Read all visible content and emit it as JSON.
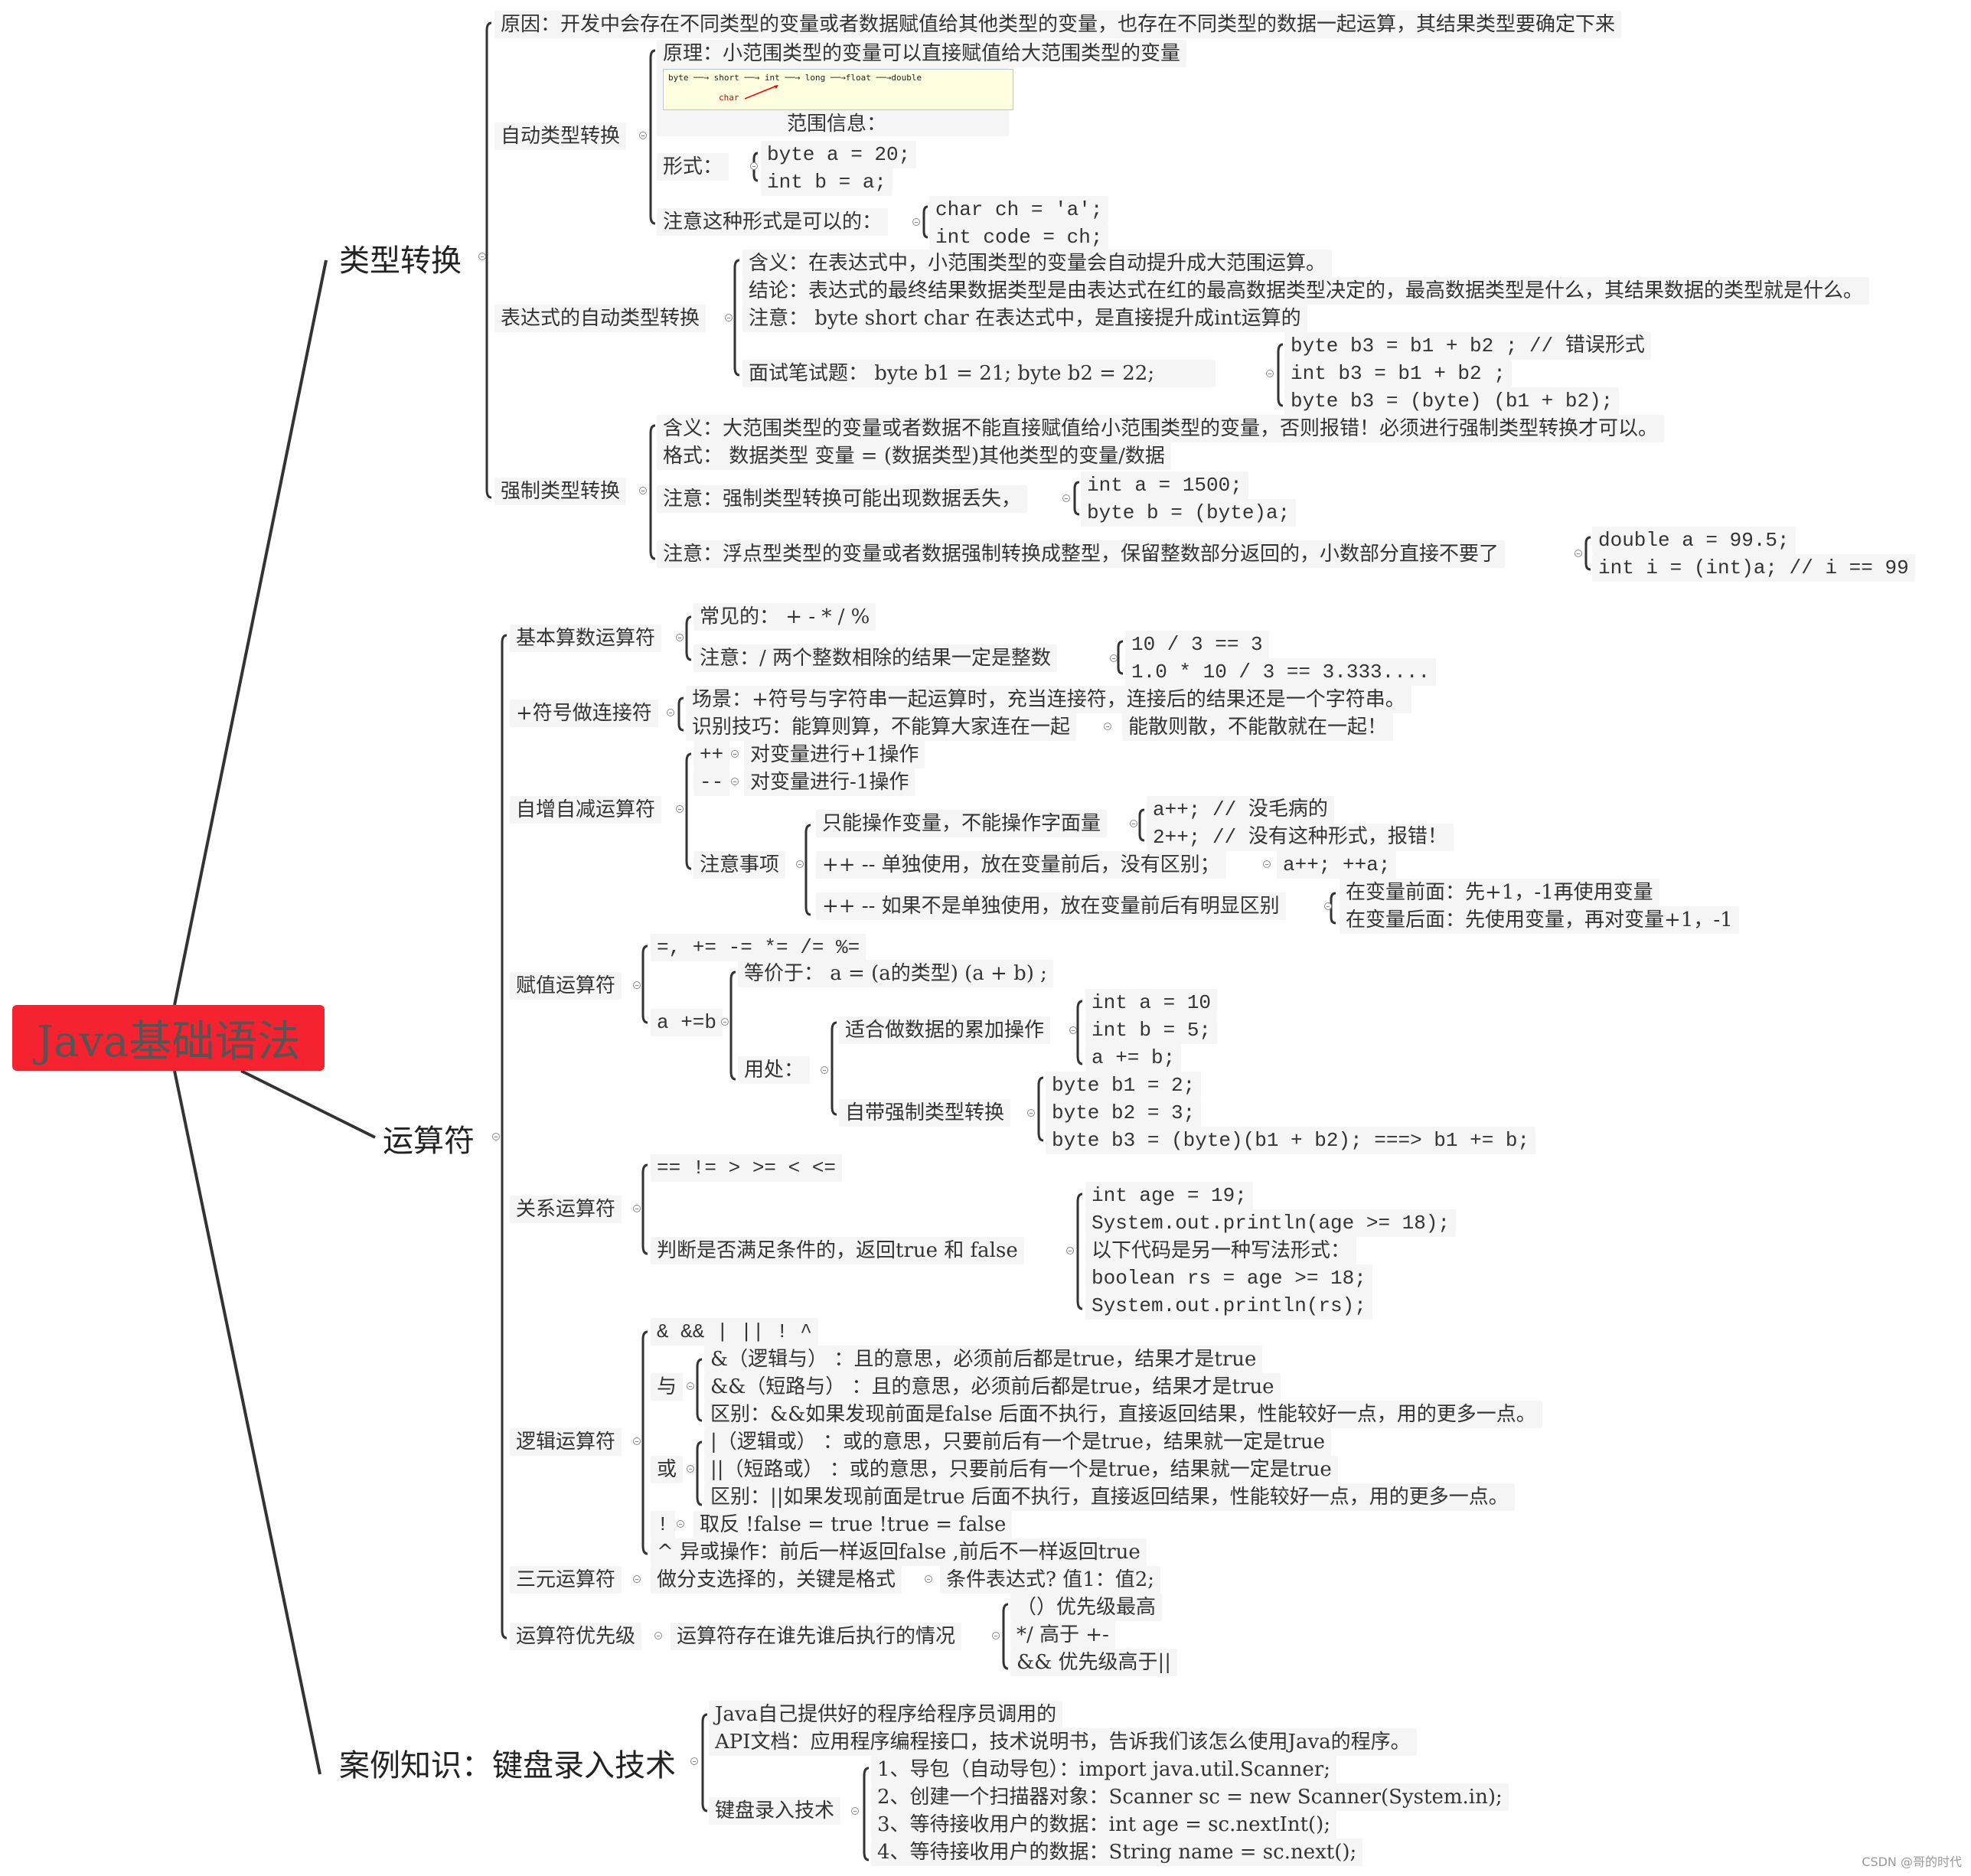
{
  "root": "Java基础语法",
  "branches": {
    "type_conversion": {
      "title": "类型转换",
      "reason": "原因：开发中会存在不同类型的变量或者数据赋值给其他类型的变量，也存在不同类型的数据一起运算，其结果类型要确定下来",
      "auto": {
        "title": "自动类型转换",
        "principle": "原理：小范围类型的变量可以直接赋值给大范围类型的变量",
        "diagram_chain": "byte ──→ short ──→ int ──→ long ──→float ──→double",
        "diagram_char": "char",
        "range_info": "范围信息：",
        "form_label": "形式：",
        "form": [
          "byte a = 20;",
          "int b = a;"
        ],
        "note_label": "注意这种形式是可以的：",
        "note": [
          "char ch = 'a';",
          "int code  = ch;"
        ]
      },
      "expr": {
        "title": "表达式的自动类型转换",
        "meaning": "含义：在表达式中，小范围类型的变量会自动提升成大范围运算。",
        "conclusion": "结论：表达式的最终结果数据类型是由表达式在红的最高数据类型决定的，最高数据类型是什么，其结果数据的类型就是什么。",
        "note": "注意： byte short char 在表达式中，是直接提升成int运算的",
        "interview": "面试笔试题： byte b1 = 21;  byte b2 = 22;",
        "answers": [
          "byte b3 = b1 + b2 ; // 错误形式",
          "int  b3 = b1 + b2 ;",
          "byte b3 = (byte) (b1 + b2);"
        ]
      },
      "cast": {
        "title": "强制类型转换",
        "meaning": "含义：大范围类型的变量或者数据不能直接赋值给小范围类型的变量，否则报错！必须进行强制类型转换才可以。",
        "format": "格式： 数据类型 变量  = (数据类型)其他类型的变量/数据",
        "note1": "注意：强制类型转换可能出现数据丢失，",
        "note1_items": [
          "int a = 1500;",
          "byte b = (byte)a;"
        ],
        "note2": "注意：浮点型类型的变量或者数据强制转换成整型，保留整数部分返回的，小数部分直接不要了",
        "note2_items": [
          "double a = 99.5;",
          "int  i = (int)a;   //  i == 99"
        ]
      }
    },
    "operators": {
      "title": "运算符",
      "arith": {
        "title": "基本算数运算符",
        "common": "常见的： + - * / %",
        "note": "注意：/  两个整数相除的结果一定是整数",
        "examples": [
          "10 / 3 == 3",
          "1.0 * 10 / 3 == 3.333...."
        ]
      },
      "concat": {
        "title": "+符号做连接符",
        "scene": "场景：+符号与字符串一起运算时，充当连接符，连接后的结果还是一个字符串。",
        "tip": "识别技巧：能算则算，不能算大家连在一起",
        "tip_child": "能散则散，不能散就在一起！"
      },
      "incdec": {
        "title": "自增自减运算符",
        "inc": "++",
        "inc_desc": "对变量进行+1操作",
        "dec": "--",
        "dec_desc": "对变量进行-1操作",
        "notes_title": "注意事项",
        "only_var": "只能操作变量，不能操作字面量",
        "only_var_items": [
          "a++;  // 没毛病的",
          "2++;  // 没有这种形式，报错！"
        ],
        "alone": "++ -- 单独使用，放在变量前后，没有区别；",
        "alone_child": "a++;   ++a;",
        "not_alone": "++ -- 如果不是单独使用，放在变量前后有明显区别",
        "not_alone_items": [
          "在变量前面：先+1，-1再使用变量",
          "在变量后面：先使用变量，再对变量+1，-1"
        ]
      },
      "assign": {
        "title": "赋值运算符",
        "ops": "=,  += -= *= /=  %=",
        "a_plus_b": "a +=b",
        "equiv": "等价于： a = (a的类型) (a + b) ;",
        "use_label": "用处：",
        "accum": "适合做数据的累加操作",
        "accum_items": [
          "int  a = 10",
          "int b  =  5;",
          "a += b;"
        ],
        "cast": "自带强制类型转换",
        "cast_items": [
          "byte b1 = 2;",
          "byte b2 = 3;",
          "byte b3 = (byte)(b1 + b2);  ===>  b1 += b;"
        ]
      },
      "relational": {
        "title": "关系运算符",
        "ops": "== != > >= < <=",
        "desc": "判断是否满足条件的，返回true 和 false",
        "items": [
          "int age = 19;",
          "System.out.println(age >= 18);",
          "以下代码是另一种写法形式：",
          "boolean rs = age >= 18;",
          "System.out.println(rs);"
        ]
      },
      "logical": {
        "title": "逻辑运算符",
        "ops": "&  &&  |  ||  !  ^",
        "and_label": "与",
        "and_items": [
          "&（逻辑与） ：且的意思，必须前后都是true，结果才是true",
          "&&（短路与） ：且的意思，必须前后都是true，结果才是true",
          "区别：&&如果发现前面是false 后面不执行，直接返回结果，性能较好一点，用的更多一点。"
        ],
        "or_label": "或",
        "or_items": [
          "|（逻辑或） ：或的意思，只要前后有一个是true，结果就一定是true",
          "||（短路或） ：或的意思，只要前后有一个是true，结果就一定是true",
          "区别：||如果发现前面是true 后面不执行，直接返回结果，性能较好一点，用的更多一点。"
        ],
        "not_label": "!",
        "not_desc": "取反  !false = true   !true = false",
        "xor": "^  异或操作：前后一样返回false ,前后不一样返回true"
      },
      "ternary": {
        "title": "三元运算符",
        "desc": "做分支选择的，关键是格式",
        "format": "条件表达式? 值1：值2;"
      },
      "priority": {
        "title": "运算符优先级",
        "desc": "运算符存在谁先谁后执行的情况",
        "items": [
          "（）优先级最高",
          "*/ 高于 +-",
          "&& 优先级高于||"
        ]
      }
    },
    "keyboard": {
      "title": "案例知识：键盘录入技术",
      "java_api": "Java自己提供好的程序给程序员调用的",
      "api_doc": "API文档：应用程序编程接口，技术说明书，告诉我们该怎么使用Java的程序。",
      "tech_label": "键盘录入技术",
      "steps": [
        "1、导包（自动导包）：import java.util.Scanner;",
        "2、创建一个扫描器对象：Scanner sc = new Scanner(System.in);",
        "3、等待接收用户的数据：int  age = sc.nextInt();",
        "4、等待接收用户的数据：String name = sc.next();"
      ]
    }
  },
  "watermark": "CSDN @哥的时代"
}
